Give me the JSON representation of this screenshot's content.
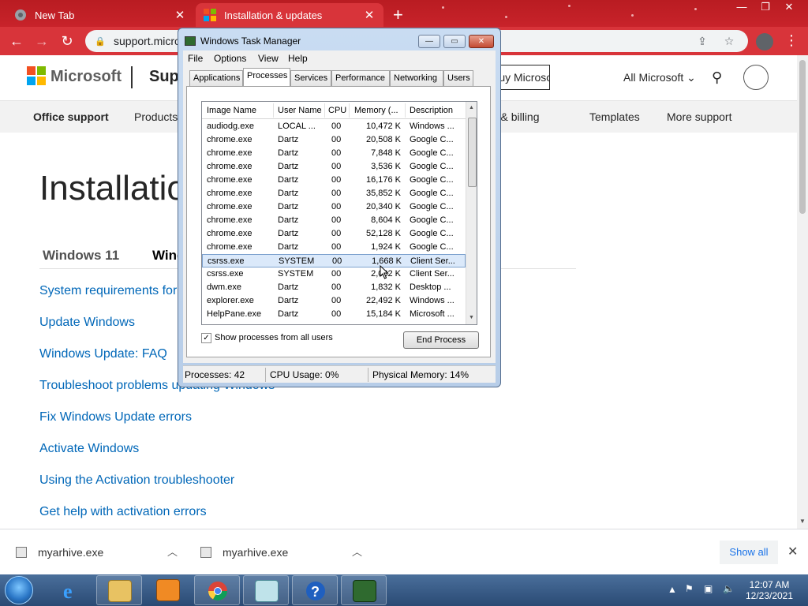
{
  "browser": {
    "tabs": [
      {
        "title": "New Tab",
        "icon": "chrome-icon"
      },
      {
        "title": "Installation & updates",
        "icon": "microsoft-icon"
      }
    ],
    "new_tab_symbol": "+",
    "url": "support.microsoft.com/en-us/windows/installation-updates-c12-25191269903c"
  },
  "page": {
    "brand": "Microsoft",
    "section": "Support",
    "header_button": "Buy Microsoft 365",
    "all_microsoft": "All Microsoft",
    "subnav": [
      "Office support",
      "Products",
      "Account & billing",
      "Templates",
      "More support"
    ],
    "title": "Installation & updates",
    "version_tabs": [
      "Windows 11",
      "Windows 10"
    ],
    "links": [
      "System requirements for Windows 10",
      "Update Windows",
      "Windows Update: FAQ",
      "Troubleshoot problems updating Windows",
      "Fix Windows Update errors",
      "Activate Windows",
      "Using the Activation troubleshooter",
      "Get help with activation errors"
    ]
  },
  "downloads": {
    "items": [
      "myarhive.exe",
      "myarhive.exe"
    ],
    "show_all": "Show all"
  },
  "taskmanager": {
    "title": "Windows Task Manager",
    "menu": [
      "File",
      "Options",
      "View",
      "Help"
    ],
    "tabs": [
      "Applications",
      "Processes",
      "Services",
      "Performance",
      "Networking",
      "Users"
    ],
    "active_tab": "Processes",
    "columns": [
      "Image Name",
      "User Name",
      "CPU",
      "Memory (...",
      "Description"
    ],
    "rows": [
      {
        "name": "audiodg.exe",
        "user": "LOCAL ...",
        "cpu": "00",
        "mem": "10,472 K",
        "desc": "Windows ..."
      },
      {
        "name": "chrome.exe",
        "user": "Dartz",
        "cpu": "00",
        "mem": "20,508 K",
        "desc": "Google C..."
      },
      {
        "name": "chrome.exe",
        "user": "Dartz",
        "cpu": "00",
        "mem": "7,848 K",
        "desc": "Google C..."
      },
      {
        "name": "chrome.exe",
        "user": "Dartz",
        "cpu": "00",
        "mem": "3,536 K",
        "desc": "Google C..."
      },
      {
        "name": "chrome.exe",
        "user": "Dartz",
        "cpu": "00",
        "mem": "16,176 K",
        "desc": "Google C..."
      },
      {
        "name": "chrome.exe",
        "user": "Dartz",
        "cpu": "00",
        "mem": "35,852 K",
        "desc": "Google C..."
      },
      {
        "name": "chrome.exe",
        "user": "Dartz",
        "cpu": "00",
        "mem": "20,340 K",
        "desc": "Google C..."
      },
      {
        "name": "chrome.exe",
        "user": "Dartz",
        "cpu": "00",
        "mem": "8,604 K",
        "desc": "Google C..."
      },
      {
        "name": "chrome.exe",
        "user": "Dartz",
        "cpu": "00",
        "mem": "52,128 K",
        "desc": "Google C..."
      },
      {
        "name": "chrome.exe",
        "user": "Dartz",
        "cpu": "00",
        "mem": "1,924 K",
        "desc": "Google C..."
      },
      {
        "name": "csrss.exe",
        "user": "SYSTEM",
        "cpu": "00",
        "mem": "1,668 K",
        "desc": "Client Ser...",
        "selected": true
      },
      {
        "name": "csrss.exe",
        "user": "SYSTEM",
        "cpu": "00",
        "mem": "2,032 K",
        "desc": "Client Ser..."
      },
      {
        "name": "dwm.exe",
        "user": "Dartz",
        "cpu": "00",
        "mem": "1,832 K",
        "desc": "Desktop ..."
      },
      {
        "name": "explorer.exe",
        "user": "Dartz",
        "cpu": "00",
        "mem": "22,492 K",
        "desc": "Windows ..."
      },
      {
        "name": "HelpPane.exe",
        "user": "Dartz",
        "cpu": "00",
        "mem": "15,184 K",
        "desc": "Microsoft ..."
      }
    ],
    "show_all_processes": "Show processes from all users",
    "show_all_checked": true,
    "end_process": "End Process",
    "status": {
      "processes": "Processes: 42",
      "cpu": "CPU Usage: 0%",
      "memory": "Physical Memory: 14%"
    }
  },
  "taskbar": {
    "pinned": [
      "internet-explorer-icon",
      "file-explorer-icon",
      "media-player-icon",
      "chrome-icon",
      "notepad-icon",
      "help-icon",
      "task-manager-icon"
    ],
    "time": "12:07 AM",
    "date": "12/23/2021"
  },
  "colors": {
    "chrome_frame": "#c8232a",
    "link": "#0067b8",
    "selection": "#dbe9fa"
  }
}
